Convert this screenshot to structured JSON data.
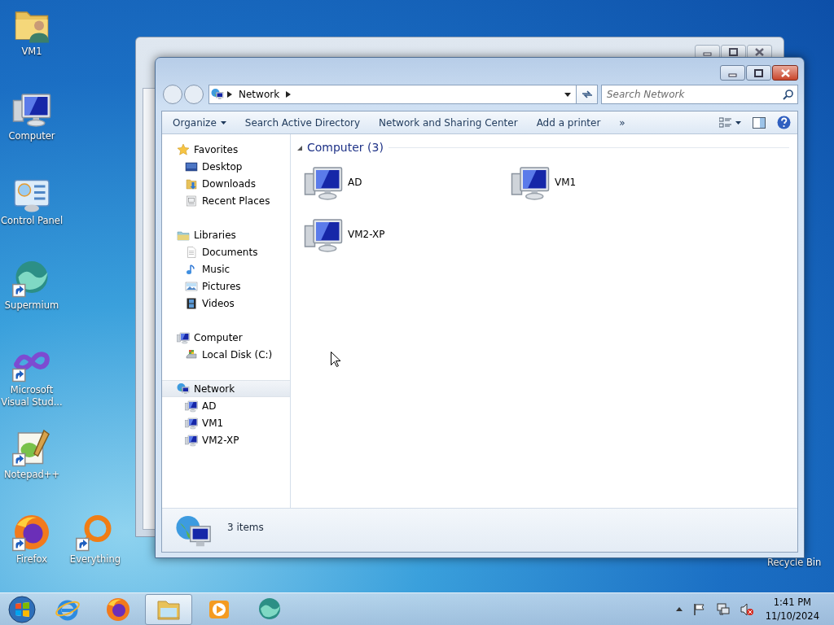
{
  "desktop_icons": [
    {
      "label": "VM1",
      "kind": "user-folder",
      "shortcut": false
    },
    {
      "label": "Computer",
      "kind": "computer",
      "shortcut": false
    },
    {
      "label": "Control Panel",
      "kind": "control-panel",
      "shortcut": false
    },
    {
      "label": "Supermium",
      "kind": "supermium",
      "shortcut": true
    },
    {
      "label": "Microsoft Visual Stud...",
      "kind": "vs",
      "shortcut": true
    },
    {
      "label": "Notepad++",
      "kind": "notepad",
      "shortcut": true
    },
    {
      "label": "Firefox",
      "kind": "firefox",
      "shortcut": true
    },
    {
      "label": "Everything",
      "kind": "everything",
      "shortcut": true
    }
  ],
  "recycle_bin_label": "Recycle Bin",
  "explorer": {
    "address": [
      "Network"
    ],
    "search": {
      "placeholder": "Search Network"
    },
    "toolbar": [
      {
        "label": "Organize",
        "dropdown": true
      },
      {
        "label": "Search Active Directory",
        "dropdown": false
      },
      {
        "label": "Network and Sharing Center",
        "dropdown": false
      },
      {
        "label": "Add a printer",
        "dropdown": false
      },
      {
        "label": "»",
        "dropdown": false
      }
    ],
    "nav": [
      {
        "label": "Favorites",
        "kind": "star",
        "selected": false,
        "children": [
          {
            "label": "Desktop",
            "kind": "desktop",
            "selected": false
          },
          {
            "label": "Downloads",
            "kind": "downloads",
            "selected": false
          },
          {
            "label": "Recent Places",
            "kind": "recent",
            "selected": false
          }
        ]
      },
      {
        "label": "Libraries",
        "kind": "library",
        "selected": false,
        "children": [
          {
            "label": "Documents",
            "kind": "document",
            "selected": false
          },
          {
            "label": "Music",
            "kind": "music",
            "selected": false
          },
          {
            "label": "Pictures",
            "kind": "pictures",
            "selected": false
          },
          {
            "label": "Videos",
            "kind": "videos",
            "selected": false
          }
        ]
      },
      {
        "label": "Computer",
        "kind": "computer",
        "selected": false,
        "children": [
          {
            "label": "Local Disk (C:)",
            "kind": "disk",
            "selected": false
          }
        ]
      },
      {
        "label": "Network",
        "kind": "network",
        "selected": true,
        "children": [
          {
            "label": "AD",
            "kind": "computer",
            "selected": false
          },
          {
            "label": "VM1",
            "kind": "computer",
            "selected": false
          },
          {
            "label": "VM2-XP",
            "kind": "computer",
            "selected": false
          }
        ]
      }
    ],
    "group": {
      "title": "Computer (3)",
      "expanded": true,
      "items": [
        {
          "label": "AD",
          "selected": false
        },
        {
          "label": "VM1",
          "selected": false
        },
        {
          "label": "VM2-XP",
          "selected": false
        }
      ]
    },
    "status": "3 items"
  },
  "taskbar": {
    "buttons": [
      {
        "kind": "ie",
        "selected": false
      },
      {
        "kind": "firefox",
        "selected": false
      },
      {
        "kind": "explorer",
        "selected": true
      },
      {
        "kind": "media",
        "selected": false
      },
      {
        "kind": "supermium",
        "selected": false
      }
    ],
    "clock": {
      "time": "1:41 PM",
      "date": "11/10/2024"
    }
  }
}
